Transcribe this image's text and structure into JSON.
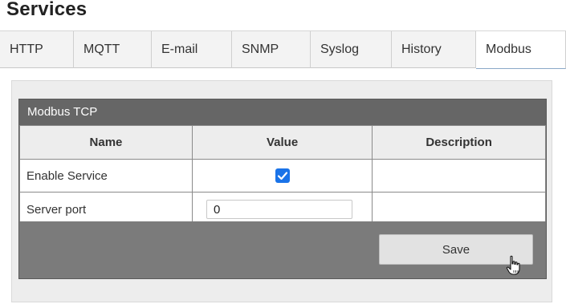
{
  "page": {
    "title": "Services"
  },
  "tabs": [
    {
      "label": "HTTP",
      "active": false
    },
    {
      "label": "MQTT",
      "active": false
    },
    {
      "label": "E-mail",
      "active": false
    },
    {
      "label": "SNMP",
      "active": false
    },
    {
      "label": "Syslog",
      "active": false
    },
    {
      "label": "History",
      "active": false
    },
    {
      "label": "Modbus",
      "active": true
    }
  ],
  "section": {
    "title": "Modbus TCP",
    "columns": [
      "Name",
      "Value",
      "Description"
    ],
    "rows": [
      {
        "name": "Enable Service",
        "type": "checkbox",
        "checked": true,
        "description": ""
      },
      {
        "name": "Server port",
        "type": "text",
        "value": "0",
        "description": ""
      }
    ]
  },
  "actions": {
    "save_label": "Save"
  },
  "colors": {
    "checkbox_accent": "#1a73e8",
    "header_bg": "#666666",
    "footer_bg": "#7b7b7b"
  },
  "icons": {
    "cursor": "hand-pointer-icon",
    "check": "checkmark-icon"
  }
}
